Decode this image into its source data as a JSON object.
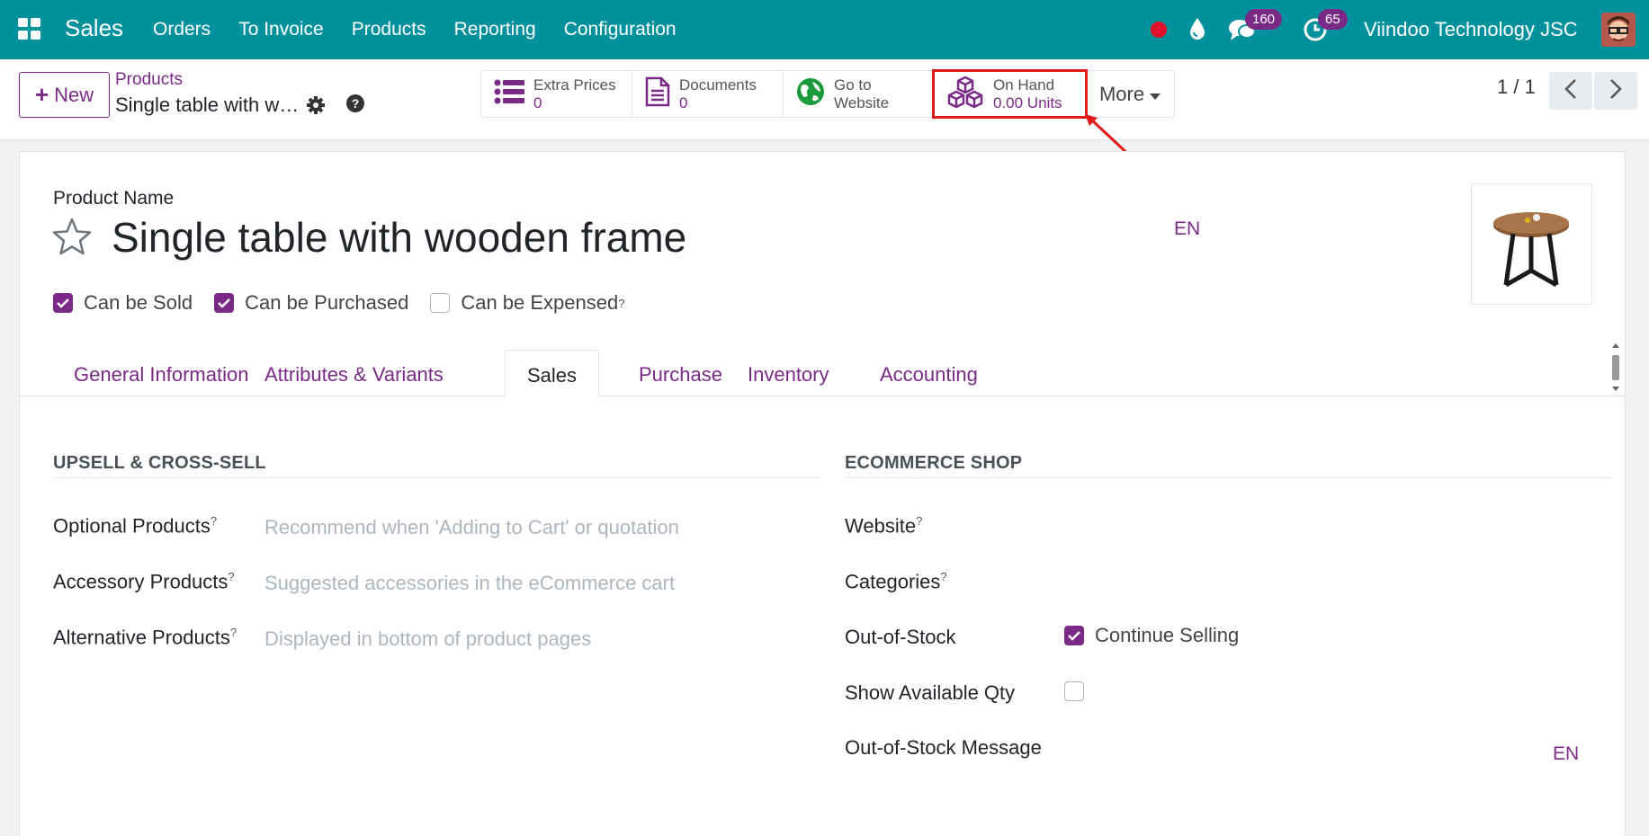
{
  "navbar": {
    "app_name": "Sales",
    "menu": [
      "Orders",
      "To Invoice",
      "Products",
      "Reporting",
      "Configuration"
    ],
    "chat_badge": "160",
    "activity_badge": "65",
    "company": "Viindoo Technology JSC"
  },
  "control": {
    "new_label": "New",
    "breadcrumb_parent": "Products",
    "breadcrumb_current": "Single table with wooden frame",
    "stats": {
      "extra_prices": {
        "label": "Extra Prices",
        "value": "0"
      },
      "documents": {
        "label": "Documents",
        "value": "0"
      },
      "website": {
        "label1": "Go to",
        "label2": "Website"
      },
      "on_hand": {
        "label": "On Hand",
        "value": "0.00 Units"
      }
    },
    "more_label": "More",
    "pager": "1 / 1"
  },
  "form": {
    "name_label": "Product Name",
    "name": "Single table with wooden frame",
    "lang": "EN",
    "can_be_sold": "Can be Sold",
    "can_be_purchased": "Can be Purchased",
    "can_be_expensed": "Can be Expensed",
    "tooltip_mark": "?"
  },
  "tabs": [
    "General Information",
    "Attributes & Variants",
    "Sales",
    "Purchase",
    "Inventory",
    "Accounting"
  ],
  "upsell": {
    "title": "UPSELL & CROSS-SELL",
    "optional_label": "Optional Products",
    "optional_ph": "Recommend when 'Adding to Cart' or quotation",
    "accessory_label": "Accessory Products",
    "accessory_ph": "Suggested accessories in the eCommerce cart",
    "alternative_label": "Alternative Products",
    "alternative_ph": "Displayed in bottom of product pages"
  },
  "ecommerce": {
    "title": "ECOMMERCE SHOP",
    "website_label": "Website",
    "categories_label": "Categories",
    "oos_label": "Out-of-Stock",
    "continue_selling": "Continue Selling",
    "show_qty_label": "Show Available Qty",
    "oos_msg_label": "Out-of-Stock Message",
    "lang": "EN"
  },
  "colors": {
    "navbar": "#01919d",
    "accent": "#7a2a86",
    "highlight": "#e11a1a"
  }
}
